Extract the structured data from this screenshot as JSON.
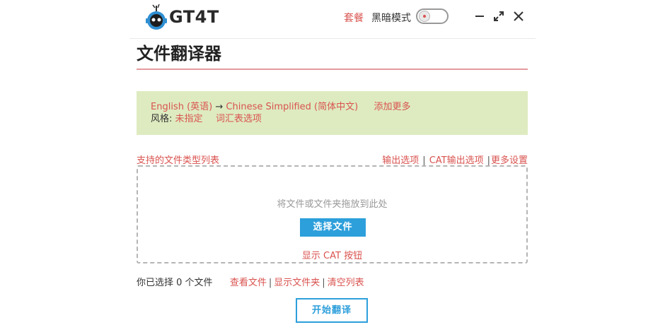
{
  "app": {
    "logo_text": "GT4T"
  },
  "header": {
    "plan_link": "套餐",
    "dark_mode_label": "黑暗模式",
    "dark_mode_on": false,
    "icons": [
      "minimize-icon",
      "expand-icon",
      "close-icon"
    ]
  },
  "page": {
    "title": "文件翻译器"
  },
  "language": {
    "source": "English (英语)",
    "arrow": "→",
    "target": "Chinese Simplified (简体中文)",
    "add_more": "添加更多",
    "style_label": "风格:",
    "style_value": "未指定",
    "glossary_options": "词汇表选项"
  },
  "options": {
    "supported_types": "支持的文件类型列表",
    "output_options": "输出选项",
    "cat_output_options": "CAT输出选项",
    "more_settings": "更多设置",
    "separator": "|"
  },
  "dropzone": {
    "hint": "将文件或文件夹拖放到此处",
    "choose_button": "选择文件",
    "show_cat_buttons": "显示 CAT 按钮"
  },
  "status": {
    "selected_text": "你已选择 0 个文件",
    "view_files": "查看文件",
    "show_folder": "显示文件夹",
    "clear_list": "清空列表",
    "separator": "|"
  },
  "actions": {
    "start_translation": "开始翻译"
  },
  "colors": {
    "accent_red": "#d9534f",
    "accent_blue": "#2d9fdb",
    "lang_box_bg": "#deebc0",
    "title_rule": "#e59aa0"
  }
}
